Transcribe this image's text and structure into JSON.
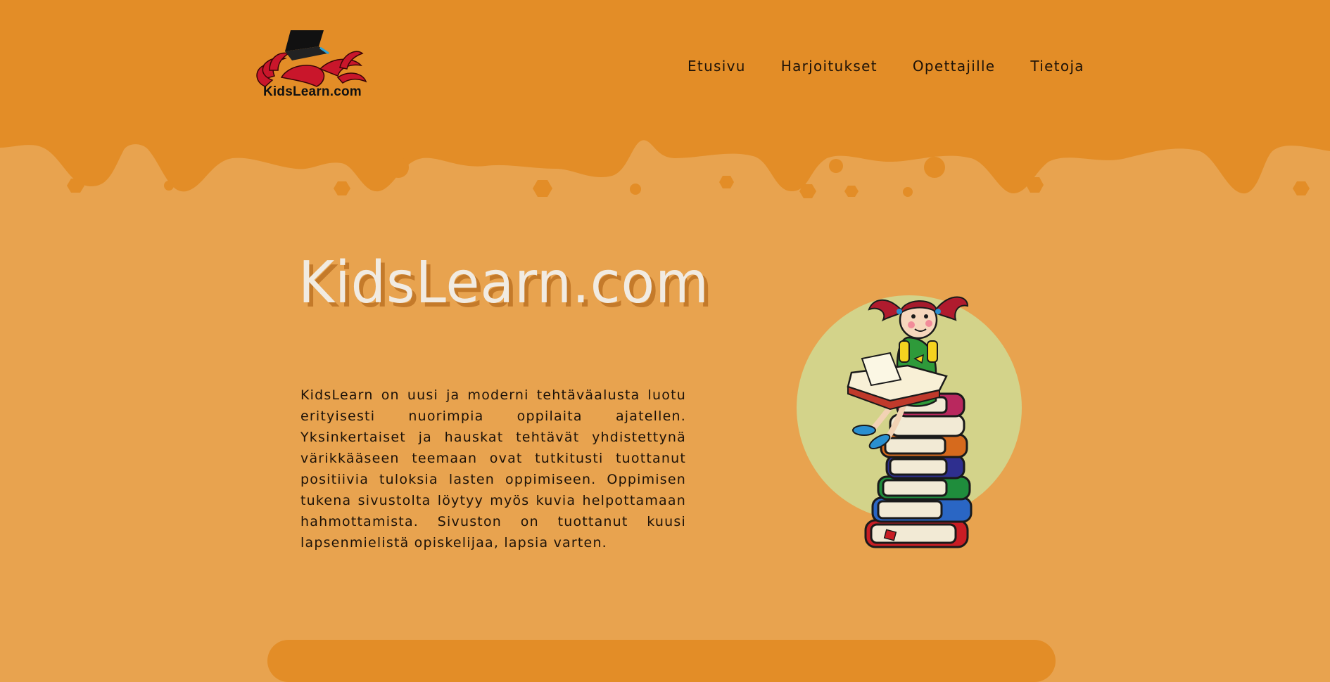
{
  "header": {
    "logo_text": "KidsLearn.com",
    "nav": [
      {
        "label": "Etusivu"
      },
      {
        "label": "Harjoitukset"
      },
      {
        "label": "Opettajille"
      },
      {
        "label": "Tietoja"
      }
    ]
  },
  "hero": {
    "title": "KidsLearn.com",
    "description": "KidsLearn on uusi ja moderni tehtäväalusta luotu erityisesti nuorimpia oppilaita ajatellen. Yksinkertaiset ja hauskat tehtävät yhdistettynä värikkääseen teemaan ovat tutkitusti tuottanut positiivia tuloksia lasten oppimiseen. Oppimisen tukena sivustolta löytyy myös kuvia helpottamaan hahmottamista. Sivuston on tuottanut kuusi lapsenmielistä opiskelijaa, lapsia varten.",
    "illustration": "girl-reading-on-book-stack"
  },
  "colors": {
    "header_bg": "#e38d27",
    "page_bg": "#e8a34f",
    "circle": "#d3d38a",
    "title_text": "#f1ebe2",
    "title_shadow": "#c47a2a"
  }
}
